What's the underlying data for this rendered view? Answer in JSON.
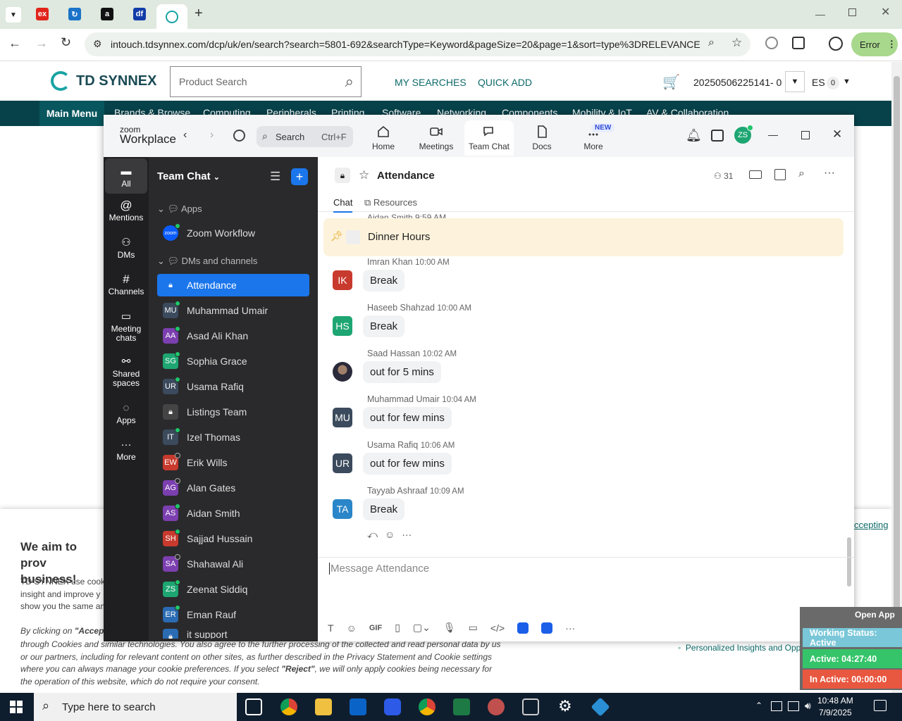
{
  "browser": {
    "url": "intouch.tdsynnex.com/dcp/uk/en/search?search=5801-692&searchType=Keyword&pageSize=20&page=1&sort=type%3DRELEVANCE",
    "error_label": "Error",
    "tabs": [
      "ex",
      "",
      "a",
      "df",
      ""
    ]
  },
  "site": {
    "logo_text": "TD SYNNEX",
    "search_placeholder": "Product Search",
    "my_searches": "MY SEARCHES",
    "quick_add": "QUICK ADD",
    "cart_id": "20250506225141- 0",
    "lang": "ES",
    "lang_count": "0",
    "main_menu": "Main Menu",
    "nav": [
      "Brands & Browse",
      "Computing",
      "Peripherals",
      "Printing",
      "Software",
      "Networking",
      "Components",
      "Mobility & IoT",
      "AV & Collaboration"
    ],
    "cookie": {
      "title": "We aim to prov business!",
      "lines": [
        "TD SYNNEX use cook",
        "insight and improve y",
        "show you the same am"
      ],
      "consent_start": "By clicking on",
      "consent_accept": "\"Accep",
      "line2": "through Cookies and similar technologies. You also agree to the further processing of the collected and read personal data by us",
      "line3": "or our partners, including for relevant content on other sites, as further described in the Privacy Statement and Cookie settings",
      "line4a": "where you can always manage your cookie preferences. If you select",
      "reject": "\"Reject\"",
      "line4b": ", we will only apply cookies being necessary for",
      "line5": "the operation of this website, which do not require your consent.",
      "accepting": "ccepting",
      "bullet": "Personalized Insights and Opportunities"
    }
  },
  "zoom": {
    "logo_small": "zoom",
    "logo_big": "Workplace",
    "search_label": "Search",
    "search_shortcut": "Ctrl+F",
    "tabs": [
      {
        "label": "Home"
      },
      {
        "label": "Meetings"
      },
      {
        "label": "Team Chat"
      },
      {
        "label": "Docs"
      },
      {
        "label": "More"
      }
    ],
    "new_badge": "NEW",
    "avatar": "ZS",
    "rail": [
      {
        "label": "All"
      },
      {
        "label": "Mentions"
      },
      {
        "label": "DMs"
      },
      {
        "label": "Channels"
      },
      {
        "label": "Meeting chats"
      },
      {
        "label": "Shared spaces"
      },
      {
        "label": "Apps"
      },
      {
        "label": "More"
      }
    ],
    "list_title": "Team Chat",
    "sections": {
      "apps": "Apps",
      "dms": "DMs and channels"
    },
    "items": [
      {
        "initials": "zoom",
        "name": "Zoom Workflow",
        "color": "#0b5cff",
        "status": "online"
      },
      {
        "initials": "",
        "name": "Attendance",
        "color": "#1b76ec",
        "status": "none"
      },
      {
        "initials": "MU",
        "name": "Muhammad Umair",
        "color": "#3b4a5c",
        "status": "online"
      },
      {
        "initials": "AA",
        "name": "Asad Ali Khan",
        "color": "#7c3fb0",
        "status": "online"
      },
      {
        "initials": "SG",
        "name": "Sophia Grace",
        "color": "#1ea672",
        "status": "online"
      },
      {
        "initials": "UR",
        "name": "Usama Rafiq",
        "color": "#3b4a5c",
        "status": "online"
      },
      {
        "initials": "",
        "name": "Listings Team",
        "color": "#444",
        "status": "none"
      },
      {
        "initials": "IT",
        "name": "Izel Thomas",
        "color": "#3b4a5c",
        "status": "online"
      },
      {
        "initials": "EW",
        "name": "Erik Wills",
        "color": "#c83a2e",
        "status": "away"
      },
      {
        "initials": "AG",
        "name": "Alan Gates",
        "color": "#7c3fb0",
        "status": "away"
      },
      {
        "initials": "AS",
        "name": "Aidan Smith",
        "color": "#7c3fb0",
        "status": "online"
      },
      {
        "initials": "SH",
        "name": "Sajjad Hussain",
        "color": "#c83a2e",
        "status": "online"
      },
      {
        "initials": "SA",
        "name": "Shahawal Ali",
        "color": "#7c3fb0",
        "status": "away"
      },
      {
        "initials": "ZS",
        "name": "Zeenat Siddiq",
        "color": "#1ea672",
        "status": "online"
      },
      {
        "initials": "ER",
        "name": "Eman Rauf",
        "color": "#2a6bb3",
        "status": "online"
      },
      {
        "initials": "",
        "name": "it support",
        "color": "#2a6bb3",
        "status": "none"
      }
    ],
    "channel": {
      "title": "Attendance",
      "members": "31",
      "tab_chat": "Chat",
      "tab_resources": "Resources",
      "prev_sender": "Aidan Smith 9:59 AM",
      "pinned": "Dinner Hours",
      "messages": [
        {
          "initials": "IK",
          "color": "#c83a2e",
          "name": "Imran Khan",
          "time": "10:00 AM",
          "text": "Break"
        },
        {
          "initials": "HS",
          "color": "#1ea672",
          "name": "Haseeb Shahzad",
          "time": "10:00 AM",
          "text": "Break"
        },
        {
          "initials": "",
          "color": "#555",
          "name": "Saad Hassan",
          "time": "10:02 AM",
          "text": "out for 5 mins"
        },
        {
          "initials": "MU",
          "color": "#3b4a5c",
          "name": "Muhammad Umair",
          "time": "10:04 AM",
          "text": "out for few mins"
        },
        {
          "initials": "UR",
          "color": "#3b4a5c",
          "name": "Usama Rafiq",
          "time": "10:06 AM",
          "text": "out for few mins"
        },
        {
          "initials": "TA",
          "color": "#2a86c8",
          "name": "Tayyab Ashraaf",
          "time": "10:09 AM",
          "text": "Break"
        }
      ],
      "composer_placeholder": "Message Attendance",
      "gif_label": "GIF"
    }
  },
  "status_widget": {
    "open_app": "Open App",
    "working": "Working Status: Active",
    "active": "Active: 04:27:40",
    "inactive": "In Active: 00:00:00"
  },
  "taskbar": {
    "search": "Type here to search",
    "time": "10:48 AM",
    "date": "7/9/2025"
  }
}
